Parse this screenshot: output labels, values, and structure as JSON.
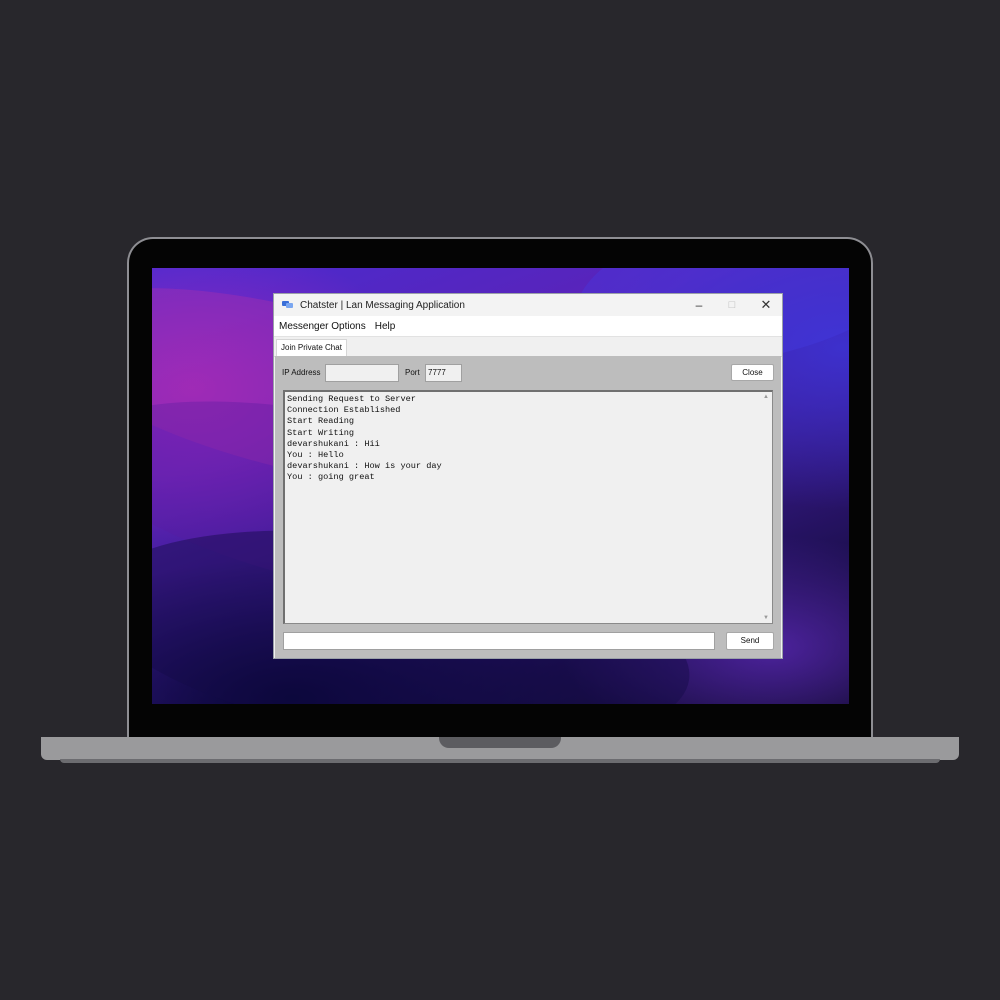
{
  "colors": {
    "page_bg": "#28272c",
    "panel_bg": "#bdbdbd",
    "window_bg": "#f0f0f0"
  },
  "window": {
    "title": "Chatster | Lan Messaging Application",
    "icon": "chat-bubbles-icon",
    "controls": {
      "minimize": "–",
      "maximize": "□",
      "close": "✕"
    }
  },
  "menu": {
    "items": [
      "Messenger Options",
      "Help"
    ]
  },
  "tabs": [
    {
      "label": "Join Private Chat",
      "active": true
    }
  ],
  "connection": {
    "ip_label": "IP Address",
    "ip_value": "",
    "port_label": "Port",
    "port_value": "7777",
    "close_label": "Close"
  },
  "chat": {
    "log_text": "Sending Request to Server\nConnection Established\nStart Reading\nStart Writing\ndevarshukani : Hii\nYou : Hello\ndevarshukani : How is your day\nYou : going great",
    "scroll_up": "▲",
    "scroll_down": "▼"
  },
  "compose": {
    "message_value": "",
    "send_label": "Send"
  }
}
